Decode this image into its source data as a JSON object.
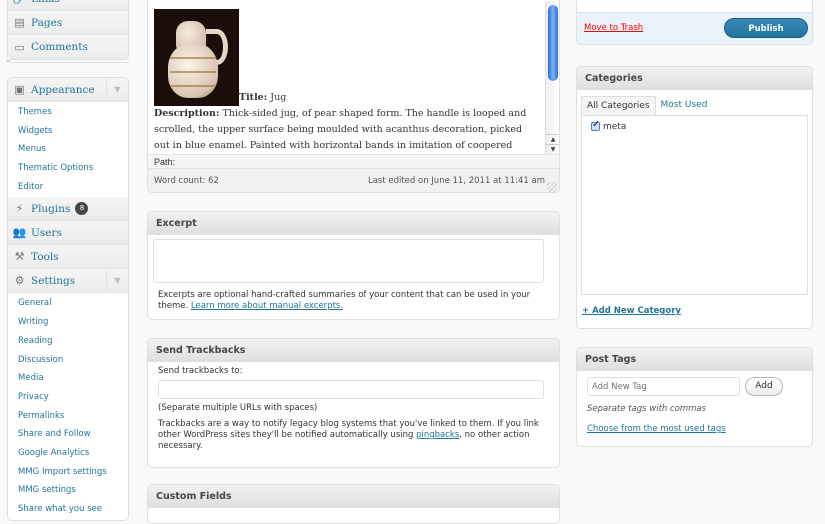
{
  "sidebar": {
    "top_group": [
      {
        "label": "Links",
        "icon": "links-icon"
      },
      {
        "label": "Pages",
        "icon": "pages-icon"
      },
      {
        "label": "Comments",
        "icon": "comments-icon"
      }
    ],
    "collapse_label": "«",
    "appearance": {
      "label": "Appearance",
      "icon": "appearance-icon",
      "submenu": [
        "Themes",
        "Widgets",
        "Menus",
        "Thematic Options",
        "Editor"
      ]
    },
    "plugins": {
      "label": "Plugins",
      "badge": "8"
    },
    "users": {
      "label": "Users"
    },
    "tools": {
      "label": "Tools"
    },
    "settings": {
      "label": "Settings",
      "submenu": [
        "General",
        "Writing",
        "Reading",
        "Discussion",
        "Media",
        "Privacy",
        "Permalinks",
        "Share and Follow",
        "Google Analytics",
        "MMG Import settings",
        "MMG settings",
        "Share what you see"
      ]
    }
  },
  "editor": {
    "title_label": "Title:",
    "title_value": "Jug",
    "description_label": "Description:",
    "description_text": "Thick-sided jug, of pear shaped form. The handle is looped and scrolled, the upper surface being moulded with acanthus decoration, picked out in blue enamel. Painted with horizontal bands in imitation of coopered vessel",
    "path_label": "Path:",
    "word_count": "Word count: 62",
    "last_edited": "Last edited on June 11, 2011 at 11:41 am"
  },
  "excerpt": {
    "heading": "Excerpt",
    "value": "",
    "help_text": "Excerpts are optional hand-crafted summaries of your content that can be used in your theme.",
    "help_link": "Learn more about manual excerpts."
  },
  "trackbacks": {
    "heading": "Send Trackbacks",
    "label": "Send trackbacks to:",
    "value": "",
    "hint": "(Separate multiple URLs with spaces)",
    "description_before": "Trackbacks are a way to notify legacy blog systems that you've linked to them. If you link other WordPress sites they'll be notified automatically using",
    "link": "pingbacks",
    "description_after": ", no other action necessary."
  },
  "custom_fields": {
    "heading": "Custom Fields"
  },
  "publish": {
    "trash_label": "Move to Trash",
    "publish_label": "Publish"
  },
  "categories": {
    "heading": "Categories",
    "tabs": [
      "All Categories",
      "Most Used"
    ],
    "items": [
      {
        "label": "meta",
        "checked": true
      }
    ],
    "add_new": "+ Add New Category"
  },
  "tags": {
    "heading": "Post Tags",
    "placeholder": "Add New Tag",
    "add_label": "Add",
    "hint": "Separate tags with commas",
    "choose_link": "Choose from the most used tags"
  }
}
